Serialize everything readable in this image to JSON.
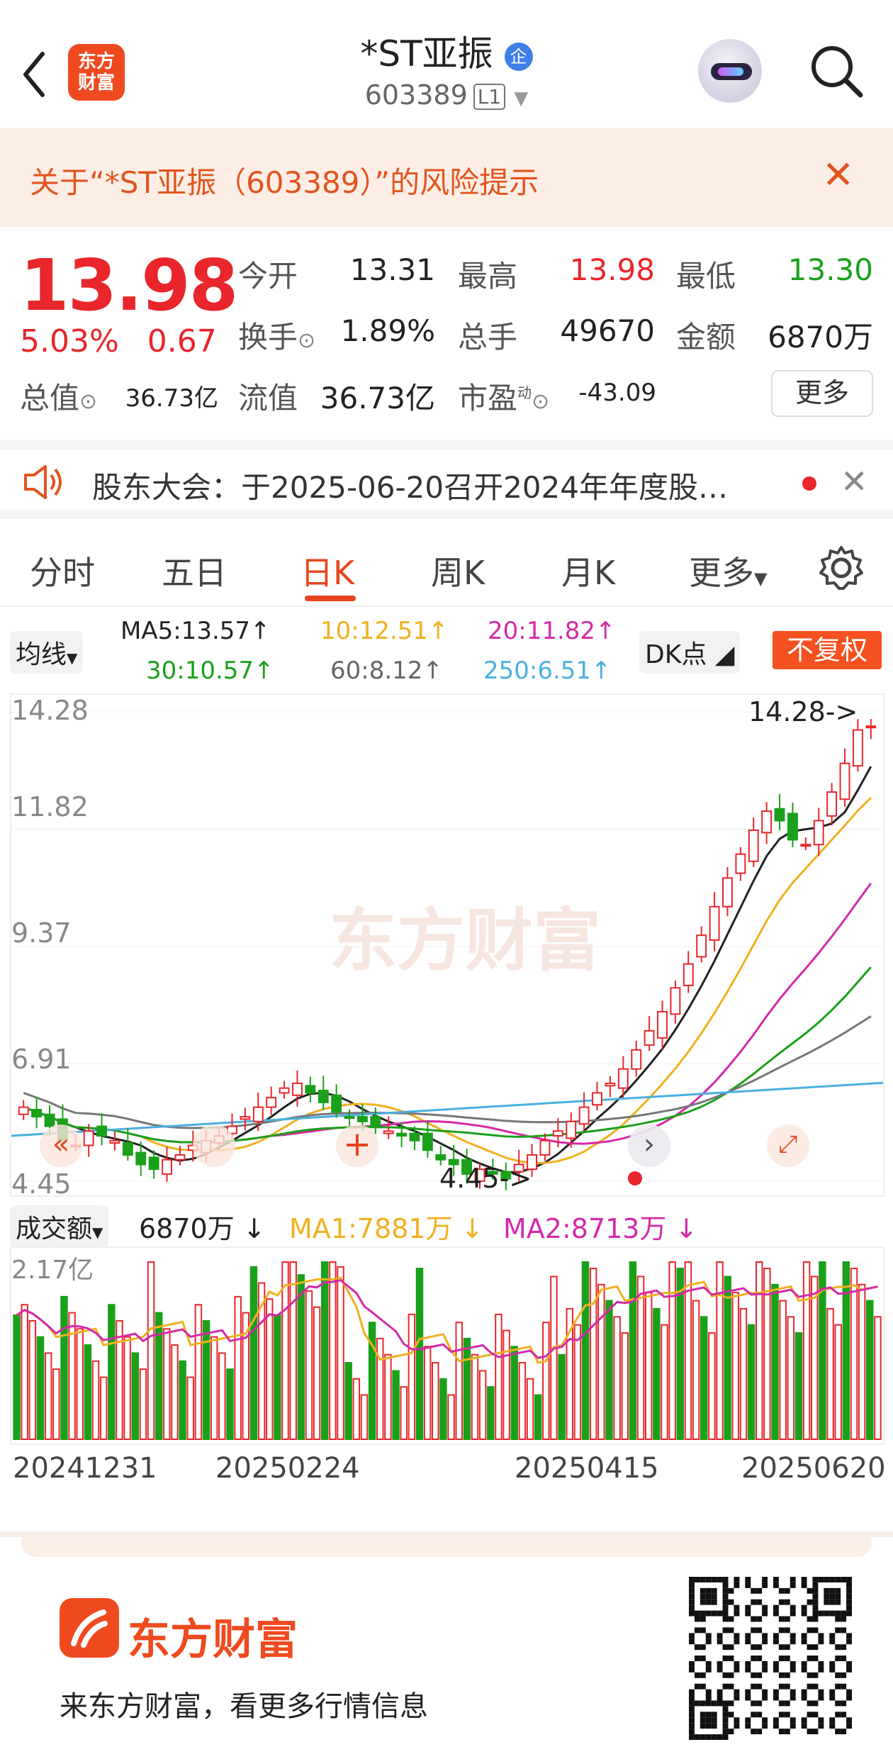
{
  "header": {
    "logo_text": "东方\n财富",
    "title": "*ST亚振",
    "title_badge": "企",
    "code": "603389",
    "level": "L1"
  },
  "risk_banner": {
    "text": "关于“*ST亚振（603389）”的风险提示"
  },
  "quote": {
    "price": "13.98",
    "change_pct": "5.03%",
    "change": "0.67",
    "open_label": "今开",
    "open": "13.31",
    "high_label": "最高",
    "high": "13.98",
    "low_label": "最低",
    "low": "13.30",
    "turnover_label": "换手",
    "turnover": "1.89%",
    "volume_label": "总手",
    "volume": "49670",
    "amount_label": "金额",
    "amount": "6870万",
    "mktcap_label": "总值",
    "mktcap": "36.73亿",
    "float_label": "流值",
    "float": "36.73亿",
    "pe_label": "市盈",
    "pe_sup": "动",
    "pe": "-43.09",
    "more_button": "更多"
  },
  "announcement": {
    "text": "股东大会：于2025-06-20召开2024年年度股…"
  },
  "tabs": [
    "分时",
    "五日",
    "日K",
    "周K",
    "月K",
    "更多"
  ],
  "active_tab": 2,
  "ma_bar": {
    "selector": "均线",
    "ma5": "MA5:13.57",
    "ma10": "10:12.51",
    "ma20": "20:11.82",
    "ma30": "30:10.57",
    "ma60": "60:8.12",
    "ma250": "250:6.51",
    "dk": "DK点",
    "adjust": "不复权"
  },
  "kline": {
    "y_labels": [
      "14.28",
      "11.82",
      "9.37",
      "6.91",
      "4.45"
    ],
    "max_label": "14.28->",
    "min_label": "4.45->",
    "watermark": "东方财富"
  },
  "volume_head": {
    "selector": "成交额",
    "value": "6870万",
    "ma1": "MA1:7881万",
    "ma2": "MA2:8713万",
    "y_label": "2.17亿"
  },
  "dates": [
    "20241231",
    "20250224",
    "20250415",
    "20250620"
  ],
  "footer": {
    "brand": "东方财富",
    "slogan": "来东方财富，看更多行情信息"
  },
  "colors": {
    "up": "#e8262b",
    "down": "#1aa01a",
    "accent": "#e8441c",
    "ma5": "#222222",
    "ma10": "#f0b020",
    "ma20": "#d42aa8",
    "ma30": "#1aa01a",
    "ma60": "#777777",
    "ma250": "#4ab0e0"
  },
  "chart_data": {
    "type": "candlestick",
    "title": "",
    "ylim": [
      4.45,
      14.28
    ],
    "x_ticks": [
      "20241231",
      "20250224",
      "20250415",
      "20250620"
    ],
    "candles_close_approx": [
      6.0,
      5.8,
      5.6,
      5.3,
      5.2,
      5.5,
      5.4,
      5.3,
      5.0,
      4.8,
      4.7,
      4.9,
      5.0,
      5.2,
      5.3,
      5.4,
      5.6,
      5.8,
      6.0,
      6.2,
      6.4,
      6.5,
      6.3,
      6.1,
      5.9,
      5.8,
      5.7,
      5.6,
      5.5,
      5.4,
      5.3,
      5.1,
      4.9,
      4.8,
      4.6,
      4.7,
      4.6,
      4.5,
      4.8,
      5.0,
      5.3,
      5.5,
      5.7,
      6.0,
      6.3,
      6.5,
      6.8,
      7.2,
      7.6,
      8.0,
      8.5,
      9.0,
      9.6,
      10.2,
      10.8,
      11.3,
      11.8,
      12.2,
      12.0,
      11.6,
      11.5,
      12.0,
      12.6,
      13.2,
      13.9,
      13.98
    ],
    "volume_note": "daily turnover bars, max 2.17亿"
  }
}
